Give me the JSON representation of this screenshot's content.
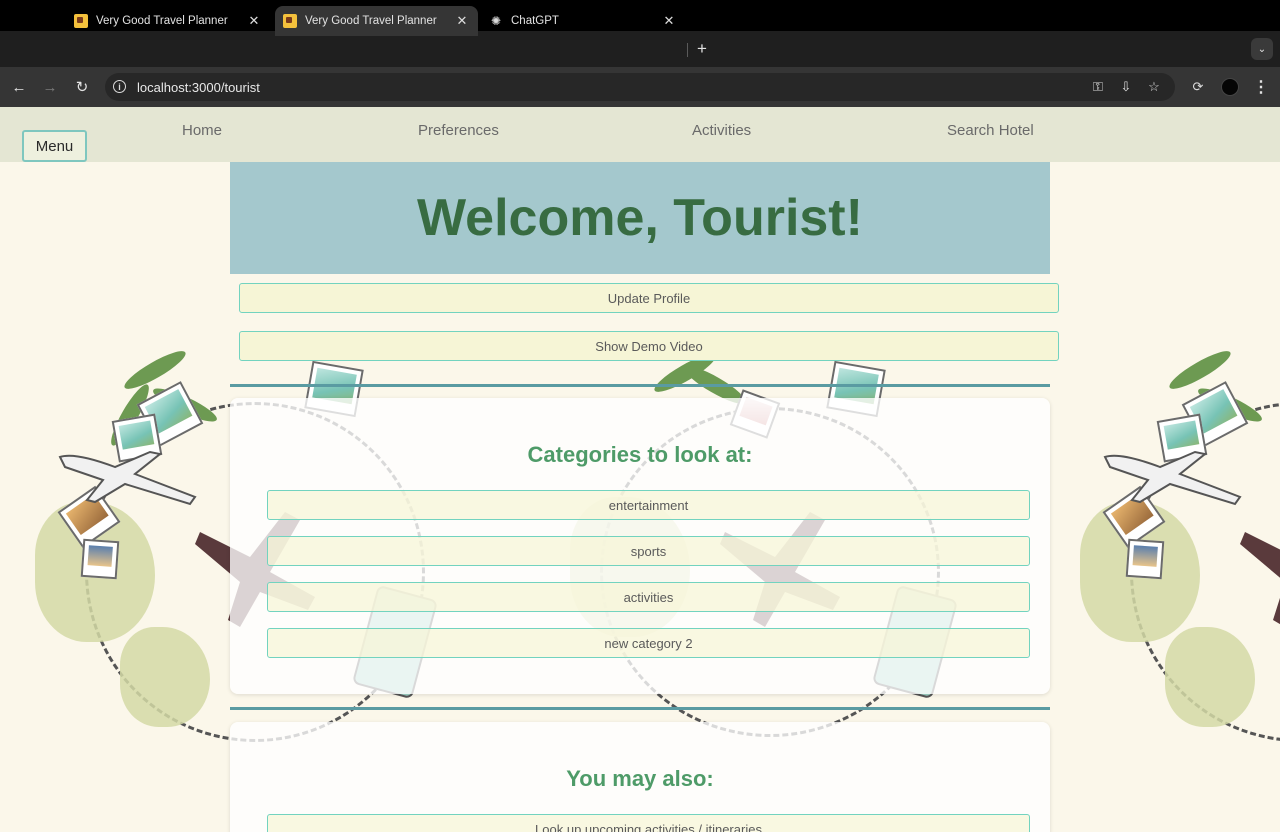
{
  "browser": {
    "tabs": [
      {
        "title": "Very Good Travel Planner",
        "active": false,
        "icon": "travel-favicon"
      },
      {
        "title": "Very Good Travel Planner",
        "active": true,
        "icon": "travel-favicon"
      },
      {
        "title": "ChatGPT",
        "active": false,
        "icon": "chatgpt-icon"
      }
    ],
    "url": "localhost:3000/tourist"
  },
  "navbar": {
    "menu_label": "Menu",
    "links": [
      "Home",
      "Preferences",
      "Activities",
      "Search Hotel"
    ]
  },
  "hero": {
    "title": "Welcome, Tourist!"
  },
  "actions": {
    "update_profile": "Update Profile",
    "show_demo_video": "Show Demo Video"
  },
  "categories": {
    "title": "Categories to look at:",
    "items": [
      "entertainment",
      "sports",
      "activities",
      "new category 2"
    ]
  },
  "also": {
    "title": "You may also:",
    "items": [
      "Look up upcoming activities / itineraries"
    ]
  },
  "colors": {
    "hero_bg": "#a4c8cd",
    "hero_text": "#386c42",
    "accent_green": "#4e9b68",
    "button_border": "#72d3bf",
    "navbar_bg": "#e4e6d3",
    "page_bg": "#fbf7ea"
  }
}
